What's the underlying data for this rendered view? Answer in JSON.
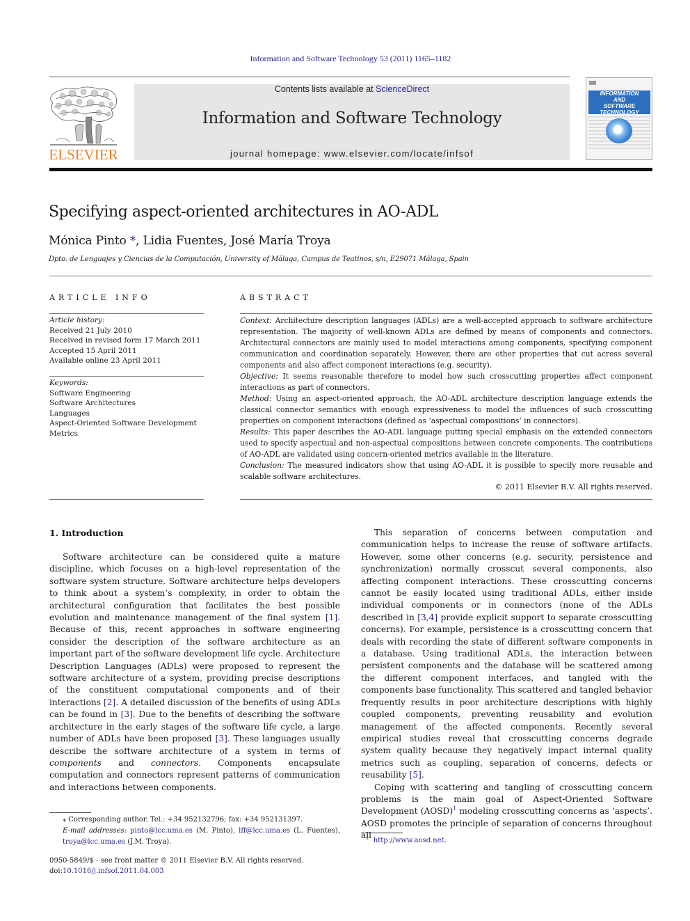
{
  "header": {
    "citation": "Information and Software Technology 53 (2011) 1165–1182",
    "publisher_logo_text": "ELSEVIER",
    "contents_prefix": "Contents lists available at ",
    "contents_link": "ScienceDirect",
    "journal_title": "Information and Software Technology",
    "homepage": "journal homepage: www.elsevier.com/locate/infsof",
    "cover": {
      "lines": [
        "INFORMATION",
        "AND",
        "SOFTWARE",
        "TECHNOLOGY"
      ],
      "accent_color": "#2c6fc0"
    },
    "logo_color": "#f07e1e",
    "link_color": "#2a2a8c"
  },
  "article": {
    "title": "Specifying aspect-oriented architectures in AO-ADL",
    "authors": [
      {
        "name": "Mónica Pinto",
        "mark": "*"
      },
      {
        "name": "Lidia Fuentes"
      },
      {
        "name": "José María Troya"
      }
    ],
    "affiliation": "Dpto. de Lenguajes y Ciencias de la Computación, University of Málaga, Campus de Teatinos, s/n, E29071 Málaga, Spain"
  },
  "article_info": {
    "heading": "ARTICLE INFO",
    "history_label": "Article history:",
    "history": [
      "Received 21 July 2010",
      "Received in revised form 17 March 2011",
      "Accepted 15 April 2011",
      "Available online 23 April 2011"
    ],
    "keywords_label": "Keywords:",
    "keywords": [
      "Software Engineering",
      "Software Architectures",
      "Languages",
      "Aspect-Oriented Software Development",
      "Metrics"
    ]
  },
  "abstract": {
    "heading": "ABSTRACT",
    "sections": [
      {
        "label": "Context:",
        "text": "Architecture description languages (ADLs) are a well-accepted approach to software architecture representation. The majority of well-known ADLs are defined by means of components and connectors. Architectural connectors are mainly used to model interactions among components, specifying component communication and coordination separately. However, there are other properties that cut across several components and also affect component interactions (e.g. security)."
      },
      {
        "label": "Objective:",
        "text": "It seems reasonable therefore to model how such crosscutting properties affect component interactions as part of connectors."
      },
      {
        "label": "Method:",
        "text": "Using an aspect-oriented approach, the AO-ADL architecture description language extends the classical connector semantics with enough expressiveness to model the influences of such crosscutting properties on component interactions (defined as ‘aspectual compositions’ in connectors)."
      },
      {
        "label": "Results:",
        "text": "This paper describes the AO-ADL language putting special emphasis on the extended connectors used to specify aspectual and non-aspectual compositions between concrete components. The contributions of AO-ADL are validated using concern-oriented metrics available in the literature."
      },
      {
        "label": "Conclusion:",
        "text": "The measured indicators show that using AO-ADL it is possible to specify more reusable and scalable software architectures."
      }
    ],
    "copyright": "© 2011 Elsevier B.V. All rights reserved."
  },
  "body": {
    "section_heading": "1. Introduction",
    "left_paragraph": {
      "t1": "Software architecture can be considered quite a mature discipline, which focuses on a high-level representation of the software system structure. Software architecture helps developers to think about a system’s complexity, in order to obtain the architectural configuration that facilitates the best possible evolution and maintenance management of the final system ",
      "r1": "[1]",
      "t2": ". Because of this, recent approaches in software engineering consider the description of the software architecture as an important part of the software development life cycle. Architecture Description Languages (ADLs) were proposed to represent the software architecture of a system, providing precise descriptions of the constituent computational components and of their interactions ",
      "r2": "[2]",
      "t3": ". A detailed discussion of the benefits of using ADLs can be found in ",
      "r3": "[3]",
      "t4": ". Due to the benefits of describing the software architecture in the early stages of the software life cycle, a large number of ADLs have been proposed ",
      "r4": "[3]",
      "t5": ". These languages usually describe the software architecture of a system in terms of ",
      "em1": "components",
      "t6": " and ",
      "em2": "connectors",
      "t7": ". Components encapsulate computation and connectors represent patterns of communication and interactions between components."
    },
    "right_paragraph_1": {
      "t1": "This separation of concerns between computation and communication helps to increase the reuse of software artifacts. However, some other concerns (e.g. security, persistence and synchronization) normally crosscut several components, also affecting component interactions. These crosscutting concerns cannot be easily located using traditional ADLs, either inside individual components or in connectors (none of the ADLs described in ",
      "r1": "[3,4]",
      "t2": " provide explicit support to separate crosscutting concerns). For example, persistence is a crosscutting concern that deals with recording the state of different software components in a database. Using traditional ADLs, the interaction between persistent components and the database will be scattered among the different component interfaces, and tangled with the components base functionality. This scattered and tangled behavior frequently results in poor architecture descriptions with highly coupled components, preventing reusability and evolution management of the affected components. Recently several empirical studies reveal that crosscutting concerns degrade system quality because they negatively impact internal quality metrics such as coupling, separation of concerns, defects or reusability ",
      "r2": "[5]",
      "t3": "."
    },
    "right_paragraph_2": {
      "t1": "Coping with scattering and tangling of crosscutting concern problems is the main goal of Aspect-Oriented Software Development (AOSD)",
      "sup": "1",
      "t2": " modeling crosscutting concerns as ‘aspects’. AOSD promotes the principle of separation of concerns throughout all"
    }
  },
  "footnotes": {
    "corresponding": "⁎ Corresponding author. Tel.: +34 952132796; fax: +34 952131397.",
    "email_label": "E-mail addresses:",
    "emails": [
      {
        "address": "pinto@lcc.uma.es",
        "owner": " (M. Pinto), "
      },
      {
        "address": "lff@lcc.uma.es",
        "owner": " (L. Fuentes), "
      },
      {
        "address": "troya@lcc.uma.es",
        "owner": " (J.M. Troya)."
      }
    ],
    "fn1_number": "1",
    "fn1_link": "http://www.aosd.net",
    "fn1_end": ".",
    "front_matter": "0950-5849/$ - see front matter © 2011 Elsevier B.V. All rights reserved.",
    "doi_prefix": "doi:",
    "doi": "10.1016/j.infsof.2011.04.003"
  }
}
